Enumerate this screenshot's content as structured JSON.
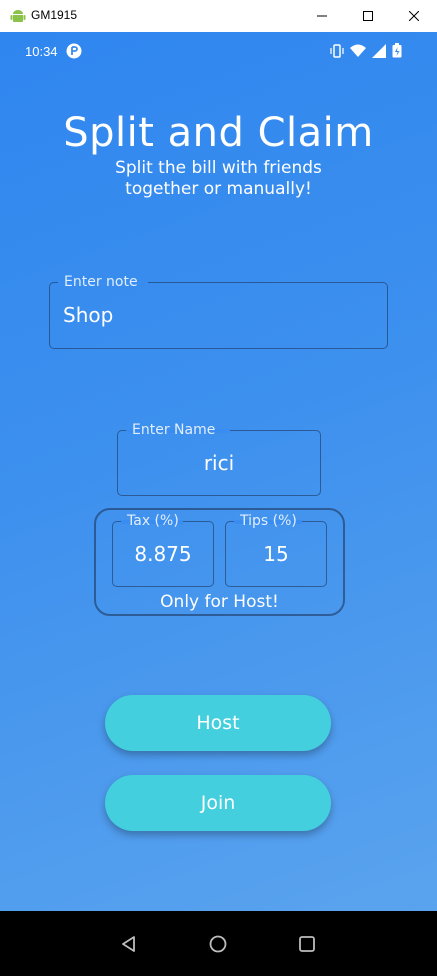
{
  "window": {
    "title": "GM1915"
  },
  "status_bar": {
    "time": "10:34"
  },
  "app": {
    "title": "Split and Claim",
    "subtitle_line1": "Split the bill with friends",
    "subtitle_line2": "together or manually!"
  },
  "note_field": {
    "label": "Enter note",
    "value": "Shop"
  },
  "name_field": {
    "label": "Enter Name",
    "value": "rici"
  },
  "host_settings": {
    "tax_label": "Tax (%)",
    "tax_value": "8.875",
    "tips_label": "Tips (%)",
    "tips_value": "15",
    "note": "Only for Host!"
  },
  "buttons": {
    "host": "Host",
    "join": "Join"
  },
  "colors": {
    "background_top": "#2f86ef",
    "background_bottom": "#5aa3ee",
    "button": "#43cfde"
  },
  "icons": [
    "android-icon",
    "minimize-icon",
    "maximize-icon",
    "close-icon",
    "app-badge-icon",
    "vibrate-icon",
    "wifi-icon",
    "signal-icon",
    "battery-icon",
    "back-icon",
    "home-icon",
    "recents-icon"
  ]
}
